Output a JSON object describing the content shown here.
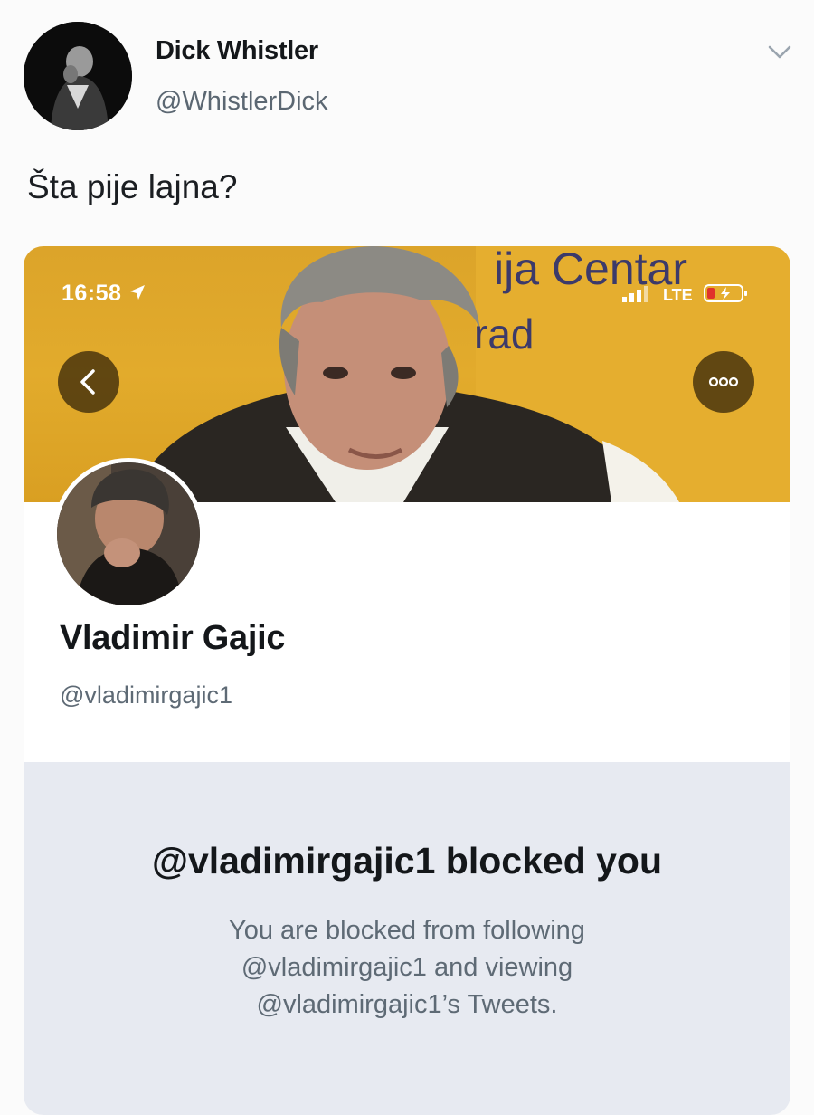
{
  "tweet": {
    "author_name": "Dick Whistler",
    "author_handle": "@WhistlerDick",
    "text": "Šta pije lajna?"
  },
  "screenshot": {
    "status_bar": {
      "time": "16:58",
      "network": "LTE"
    },
    "banner_text": {
      "line1": "ija Centar",
      "line2": "rad"
    },
    "profile": {
      "name": "Vladimir Gajic",
      "handle": "@vladimirgajic1"
    },
    "blocked": {
      "title": "@vladimirgajic1 blocked you",
      "body_lines": [
        "You are blocked from following",
        "@vladimirgajic1 and viewing",
        "@vladimirgajic1’s Tweets."
      ]
    }
  },
  "colors": {
    "banner_yellow": "#e2ab2c",
    "blocked_panel_bg": "#e7eaf1",
    "secondary_text": "#5e6a75"
  },
  "icons": [
    "chevron-down-icon",
    "location-arrow-icon",
    "signal-icon",
    "battery-charging-icon",
    "back-chevron-icon",
    "more-options-icon"
  ]
}
